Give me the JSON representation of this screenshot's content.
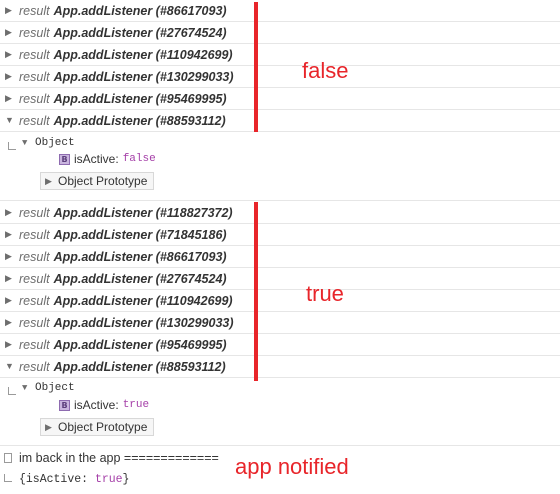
{
  "group1": {
    "rows": [
      {
        "kw": "result",
        "name": "App.addListener (#86617093)",
        "expanded": false
      },
      {
        "kw": "result",
        "name": "App.addListener (#27674524)",
        "expanded": false
      },
      {
        "kw": "result",
        "name": "App.addListener (#110942699)",
        "expanded": false
      },
      {
        "kw": "result",
        "name": "App.addListener (#130299033)",
        "expanded": false
      },
      {
        "kw": "result",
        "name": "App.addListener (#95469995)",
        "expanded": false
      },
      {
        "kw": "result",
        "name": "App.addListener (#88593112)",
        "expanded": true
      }
    ],
    "object": {
      "label": "Object",
      "prop_badge": "B",
      "prop_key": "isActive:",
      "prop_value": "false",
      "prototype": "Object Prototype"
    },
    "annotation": "false"
  },
  "group2": {
    "rows": [
      {
        "kw": "result",
        "name": "App.addListener (#118827372)",
        "expanded": false
      },
      {
        "kw": "result",
        "name": "App.addListener (#71845186)",
        "expanded": false
      },
      {
        "kw": "result",
        "name": "App.addListener (#86617093)",
        "expanded": false
      },
      {
        "kw": "result",
        "name": "App.addListener (#27674524)",
        "expanded": false
      },
      {
        "kw": "result",
        "name": "App.addListener (#110942699)",
        "expanded": false
      },
      {
        "kw": "result",
        "name": "App.addListener (#130299033)",
        "expanded": false
      },
      {
        "kw": "result",
        "name": "App.addListener (#95469995)",
        "expanded": false
      },
      {
        "kw": "result",
        "name": "App.addListener (#88593112)",
        "expanded": true
      }
    ],
    "object": {
      "label": "Object",
      "prop_badge": "B",
      "prop_key": "isActive:",
      "prop_value": "true",
      "prototype": "Object Prototype"
    },
    "annotation": "true"
  },
  "log": {
    "message": "im back in the app =============",
    "object_open": "{",
    "object_key": "isActive",
    "object_sep": ": ",
    "object_value": "true",
    "object_close": "}",
    "annotation": "app notified"
  },
  "colors": {
    "annotation": "#e8252a",
    "value": "#a53fa8",
    "badge": "#c9b5de"
  },
  "icons": {
    "collapsed": "disclosure-triangle-right",
    "expanded": "disclosure-triangle-down",
    "return": "return-arrow-icon",
    "log": "log-entry-icon"
  }
}
